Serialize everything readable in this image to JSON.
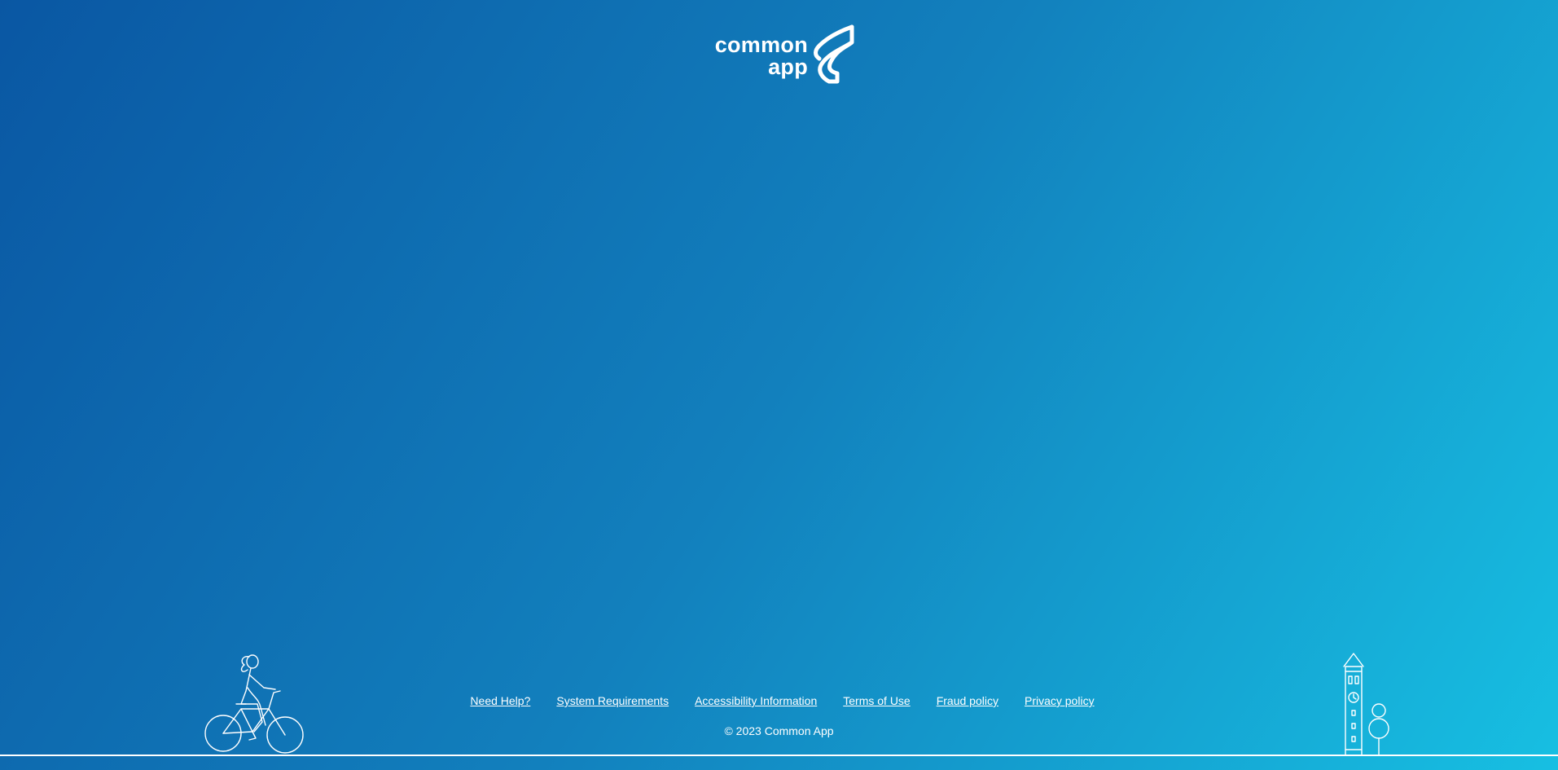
{
  "brand": {
    "wordmark_line1": "common",
    "wordmark_line2": "app",
    "logo_icon": "common-app-logo-mark"
  },
  "colors": {
    "gradient_start": "#0a57a3",
    "gradient_end": "#17bfe2",
    "text": "#ffffff"
  },
  "footer": {
    "links": [
      {
        "label": "Need Help?"
      },
      {
        "label": "System Requirements"
      },
      {
        "label": "Accessibility Information"
      },
      {
        "label": "Terms of Use"
      },
      {
        "label": "Fraud policy"
      },
      {
        "label": "Privacy policy"
      }
    ],
    "copyright": "© 2023 Common App"
  },
  "illustrations": {
    "left": "cyclist-illustration",
    "right": "clock-tower-illustration"
  }
}
